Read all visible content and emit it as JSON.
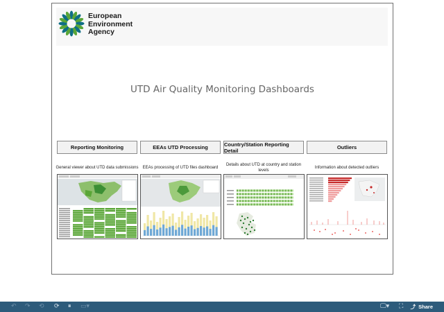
{
  "header": {
    "org_name_lines": [
      "European",
      "Environment",
      "Agency"
    ],
    "logo_colors": {
      "green": "#5aa637",
      "teal": "#0f6e85"
    }
  },
  "page_title": "UTD Air Quality Monitoring Dashboards",
  "nav_buttons": [
    {
      "label": "Reporting Monitoring"
    },
    {
      "label": "EEAs UTD Processing"
    },
    {
      "label": "Country/Station Reporting Detail"
    },
    {
      "label": "Outliers"
    }
  ],
  "descriptions": [
    "General viewer about UTD data submissions",
    "EEAs processing of UTD files dashboard",
    "Details about UTD at country and station levels",
    "Information about detected outliers"
  ],
  "thumbnails": [
    {
      "icon": "dashboard-thumbnail-map-table"
    },
    {
      "icon": "dashboard-thumbnail-map-bars"
    },
    {
      "icon": "dashboard-thumbnail-status-map"
    },
    {
      "icon": "dashboard-thumbnail-outlier-scatter"
    }
  ],
  "toolbar": {
    "icons": [
      "undo-icon",
      "redo-icon",
      "revert-icon",
      "refresh-icon",
      "pause-icon",
      "view-icon",
      "device-preview-icon",
      "fullscreen-icon",
      "share-icon"
    ],
    "share_label": "Share",
    "bar_color": "#2d5b7b"
  }
}
